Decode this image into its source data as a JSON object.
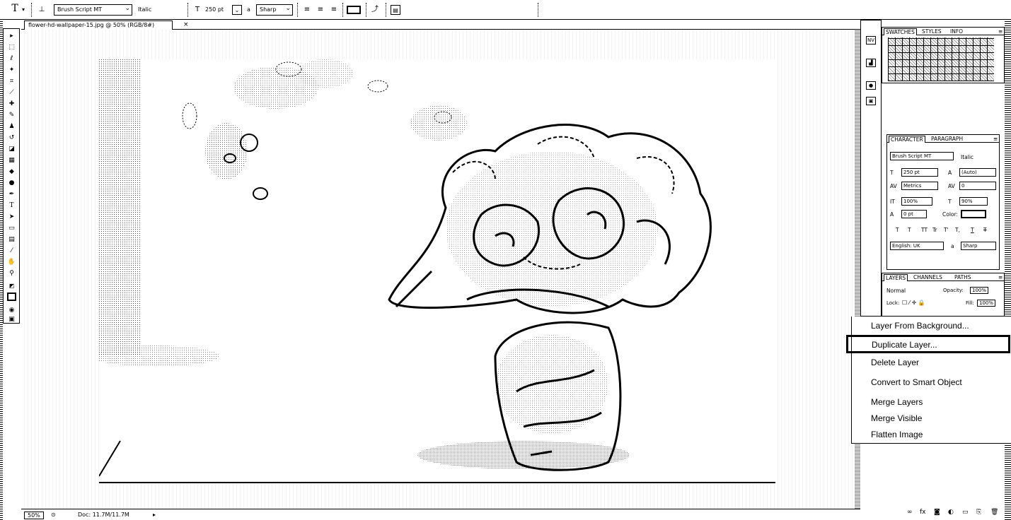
{
  "options_bar": {
    "tool_icon": "T",
    "orientation_icon": "T-orientation-icon",
    "font_family": "Brush Script MT",
    "font_style": "Italic",
    "font_size": "250 pt",
    "aa_label": "a",
    "aa_mode": "Sharp"
  },
  "document": {
    "tab_title": "flower-hd-wallpaper-15.jpg @ 50% (RGB/8#)",
    "close_glyph": "×",
    "zoom": "50%",
    "doc_info": "Doc: 11.7M/11.7M"
  },
  "panels": {
    "swatches_tabs": [
      "SWATCHES",
      "STYLES",
      "INFO"
    ],
    "character_tabs": [
      "CHARACTER",
      "PARAGRAPH"
    ],
    "character": {
      "font_family": "Brush Script MT",
      "font_style": "Italic",
      "font_size": "250 pt",
      "leading": "(Auto)",
      "kerning": "Metrics",
      "tracking": "0",
      "vertical_scale": "100%",
      "horizontal_scale": "90%",
      "baseline_shift": "0 pt",
      "color_label": "Color:",
      "language": "English: UK",
      "aa_mode": "Sharp",
      "style_buttons": [
        "T",
        "T",
        "TT",
        "Tr",
        "T'",
        "T,",
        "T",
        "T"
      ]
    },
    "layers_tabs": [
      "LAYERS",
      "CHANNELS",
      "PATHS"
    ],
    "layers": {
      "blend_mode": "Normal",
      "opacity_label": "Opacity:",
      "opacity": "100%",
      "lock_label": "Lock:",
      "fill_label": "Fill:",
      "fill": "100%"
    }
  },
  "context_menu": {
    "items": [
      "Layer From Background...",
      "Duplicate Layer...",
      "Delete Layer",
      "Convert to Smart Object",
      "Merge Layers",
      "Merge Visible",
      "Flatten Image"
    ]
  }
}
